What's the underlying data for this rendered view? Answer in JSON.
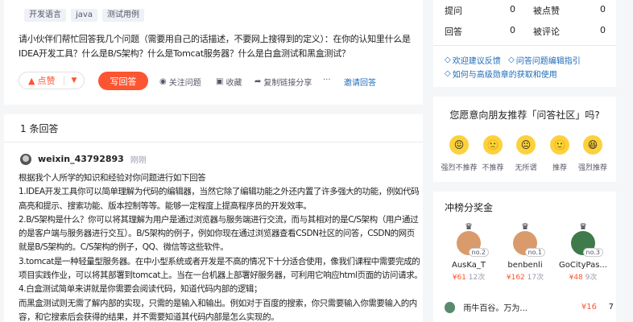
{
  "question": {
    "tags": [
      "开发语言",
      "java",
      "测试用例"
    ],
    "text": "请小伙伴们帮忙回答我几个问题（需要用自己的话描述，不要网上搜得到的定义）：在你的认知里什么是IDEA开发工具？什么是B/S架构？什么是Tomcat服务器？什么是白盒测试和黑盒测试？",
    "like_label": "点赞",
    "answer_label": "写回答",
    "follow_label": "关注问题",
    "collect_label": "收藏",
    "share_label": "复制链接分享",
    "more_label": "···",
    "invite_label": "邀请回答"
  },
  "answers": {
    "count_label": "1 条回答",
    "author": "weixin_43792893",
    "time": "刚刚",
    "lines": [
      "根据我个人所学的知识和经验对你问题进行如下回答",
      "1.IDEA开发工具你可以简单理解为代码的编辑器，当然它除了编辑功能之外还内置了许多强大的功能，例如代码",
      "高亮和提示、搜索功能、版本控制等等。能够一定程度上提高程序员的开发效率。",
      "2.B/S架构是什么？你可以将其理解为用户是通过浏览器与服务端进行交流，而与其相对的是C/S架构（用户通过",
      "的是客户端与服务器进行交互）。B/S架构的例子，例如你现在通过浏览器查看CSDN社区的问答，CSDN的网页",
      "就是B/S架构的。C/S架构的例子，QQ、微信等这些软件。",
      "3.tomcat是一种轻量型服务器。在中小型系统或者开发是不高的情况下十分适合使用，像我们课程中需要完成的",
      "项目实践作业，可以将其部署到tomcat上。当在一台机器上部署好服务器，可利用它响应html页面的访问请求。",
      "4.白盒测试简单来讲就是你需要会阅读代码，知道代码内部的逻辑；",
      "而黑盒测试则无需了解内部的实现，只需的是输入和输出。例如对于百度的搜索，你只需要输入你需要输入的内",
      "容，和它搜索后会获得的结果，并不需要知道其代码内部是怎么实现的。"
    ]
  },
  "stats": {
    "items": [
      {
        "label": "提问",
        "value": "0"
      },
      {
        "label": "被点赞",
        "value": "0"
      },
      {
        "label": "回答",
        "value": "0"
      },
      {
        "label": "被评论",
        "value": "0"
      }
    ],
    "links": [
      "欢迎建议反馈",
      "问答问题编辑指引",
      "如何与高级勋章的获取和使用"
    ]
  },
  "recommend": {
    "title": "您愿意向朋友推荐「问答社区」吗?",
    "options": [
      {
        "label": "强烈不推荐",
        "face": "😖"
      },
      {
        "label": "不推荐",
        "face": "🙁"
      },
      {
        "label": "无所谓",
        "face": "😐"
      },
      {
        "label": "推荐",
        "face": "🙂"
      },
      {
        "label": "强烈推荐",
        "face": "😆"
      }
    ]
  },
  "ranking": {
    "title": "冲榜分奖金",
    "top": [
      {
        "name": "AusKa_T",
        "money": "¥61",
        "count": "12次",
        "badge": "no.2"
      },
      {
        "name": "benbenli",
        "money": "¥162",
        "count": "17次",
        "badge": "no.1"
      },
      {
        "name": "GoCityPas...",
        "money": "¥48",
        "count": "9次",
        "badge": "no.3"
      }
    ],
    "fourth": {
      "name": "雨牛百谷。万为...",
      "money": "¥16",
      "rank": "7"
    }
  },
  "colors": {
    "accent": "#fc5531",
    "link": "#1c6bbb",
    "face": "#fcd13b"
  }
}
